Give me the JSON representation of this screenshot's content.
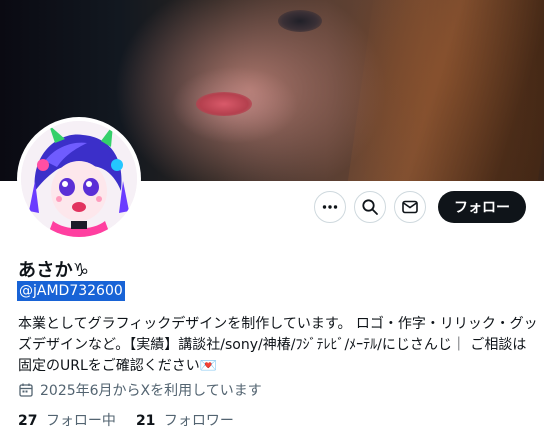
{
  "profile": {
    "display_name": "あさか♑",
    "handle": "@jAMD732600",
    "bio_lines": [
      "本業としてグラフィックデザインを制作しています。 ロゴ・作字・リリック・グッ",
      "ズデザインなど。【実績】講談社/sony/神椿/ﾌｼﾞﾃﾚﾋﾞ/ﾒｰﾃﾙ/にじさんじ｜ ご相談は",
      "固定のURLをご確認ください💌"
    ],
    "joined": "2025年6月からXを利用しています"
  },
  "actions": {
    "follow_label": "フォロー",
    "more_icon": "more-icon",
    "search_icon": "search-icon",
    "message_icon": "message-icon"
  },
  "stats": {
    "following_count": "27",
    "following_label": "フォロー中",
    "followers_count": "21",
    "followers_label": "フォロワー"
  },
  "colors": {
    "follow_button_bg": "#0f1419",
    "handle_highlight": "#1863d6",
    "secondary_text": "#536471"
  }
}
